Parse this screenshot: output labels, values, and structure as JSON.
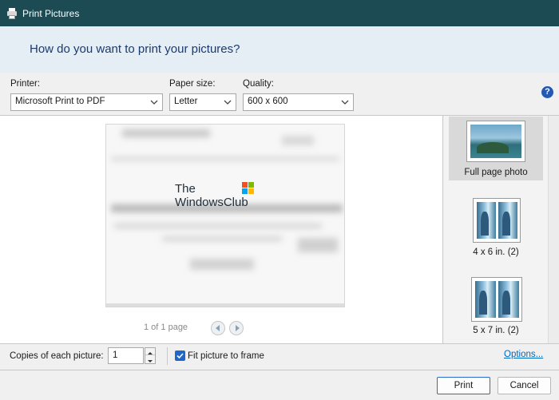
{
  "window": {
    "title": "Print Pictures"
  },
  "header": {
    "question": "How do you want to print your pictures?"
  },
  "printer": {
    "label": "Printer:",
    "value": "Microsoft Print to PDF"
  },
  "paper_size": {
    "label": "Paper size:",
    "value": "Letter"
  },
  "quality": {
    "label": "Quality:",
    "value": "600 x 600"
  },
  "help": {
    "glyph": "?"
  },
  "preview": {
    "watermark_line1": "The",
    "watermark_line2": "WindowsClub",
    "page_counter": "1 of 1 page"
  },
  "layouts": [
    {
      "label": "Full page photo",
      "selected": true
    },
    {
      "label": "4 x 6 in. (2)",
      "selected": false
    },
    {
      "label": "5 x 7 in. (2)",
      "selected": false
    }
  ],
  "copies": {
    "label": "Copies of each picture:",
    "value": "1"
  },
  "fit": {
    "label": "Fit picture to frame",
    "checked": true
  },
  "options_link": "Options...",
  "buttons": {
    "print": "Print",
    "cancel": "Cancel"
  },
  "colors": {
    "titlebar": "#1d4b54",
    "header_bg": "#e4eef4",
    "accent": "#1f67c8",
    "link": "#0067c0"
  }
}
